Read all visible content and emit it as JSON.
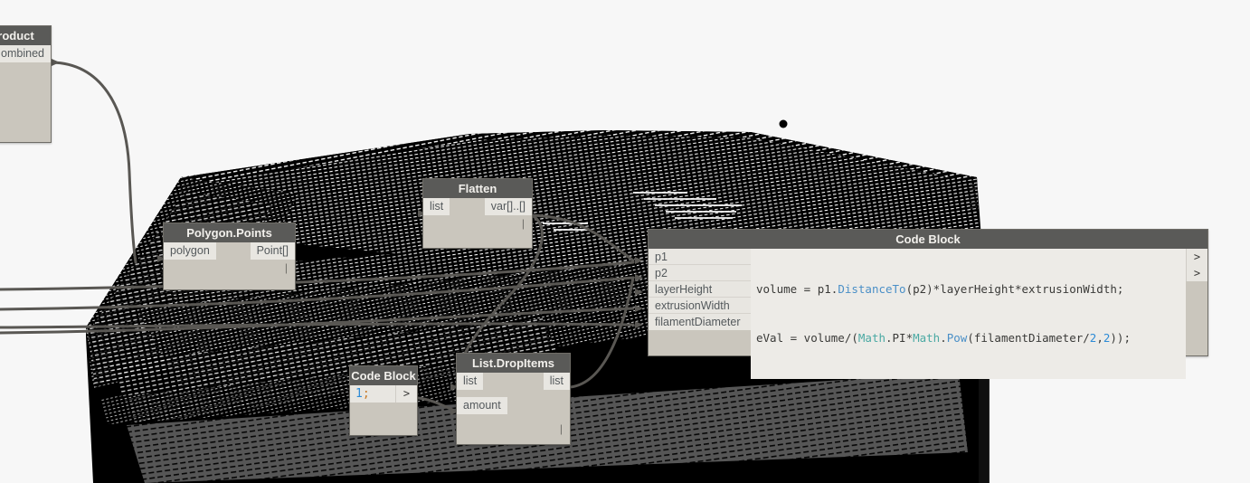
{
  "app": {
    "canvas_background": "#f7f7f7",
    "node_header_color": "#5a5a58",
    "node_body_color": "#cac6bd",
    "port_color": "#e8e6e1",
    "wire_color": "#595753",
    "geometry_color": "#000000"
  },
  "nodes": {
    "product": {
      "title": "roduct",
      "ports_in": [],
      "ports_out": [
        "ombined"
      ],
      "tick": ""
    },
    "polygon_points": {
      "title": "Polygon.Points",
      "ports_in": [
        "polygon"
      ],
      "ports_out": [
        "Point[]"
      ],
      "tick": "|"
    },
    "flatten": {
      "title": "Flatten",
      "ports_in": [
        "list"
      ],
      "ports_out": [
        "var[]..[]"
      ],
      "tick": "|"
    },
    "code_block_main": {
      "title": "Code Block",
      "ports_in": [
        "p1",
        "p2",
        "layerHeight",
        "extrusionWidth",
        "filamentDiameter"
      ],
      "chevrons": [
        ">",
        ">"
      ],
      "code_lines": [
        {
          "text": "volume = p1.DistanceTo(p2)*layerHeight*extrusionWidth;",
          "tokens": [
            {
              "t": "volume = p1.",
              "c": "tok-id"
            },
            {
              "t": "DistanceTo",
              "c": "tok-fn"
            },
            {
              "t": "(p2)*layerHeight*extrusionWidth;",
              "c": "tok-id"
            }
          ]
        },
        {
          "text": "eVal = volume/(Math.PI*Math.Pow(filamentDiameter/2,2));",
          "tokens": [
            {
              "t": "eVal = volume/(",
              "c": "tok-id"
            },
            {
              "t": "Math",
              "c": "tok-cls"
            },
            {
              "t": ".PI*",
              "c": "tok-id"
            },
            {
              "t": "Math",
              "c": "tok-cls"
            },
            {
              "t": ".",
              "c": "tok-id"
            },
            {
              "t": "Pow",
              "c": "tok-fn"
            },
            {
              "t": "(filamentDiameter/",
              "c": "tok-id"
            },
            {
              "t": "2",
              "c": "tok-num"
            },
            {
              "t": ",",
              "c": "tok-id"
            },
            {
              "t": "2",
              "c": "tok-num"
            },
            {
              "t": "));",
              "c": "tok-id"
            }
          ]
        }
      ]
    },
    "code_block_small": {
      "title": "Code Block",
      "code_value": "1;",
      "code_number": "1",
      "code_semicolon": ";",
      "chevron": ">"
    },
    "list_dropitems": {
      "title": "List.DropItems",
      "ports_in": [
        "list",
        "amount"
      ],
      "ports_out": [
        "list"
      ],
      "tick": "|"
    }
  }
}
